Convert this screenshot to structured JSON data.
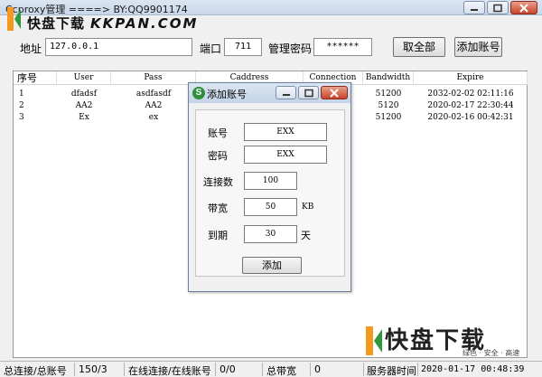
{
  "window": {
    "title": "Ccproxy管理 ====> BY:QQ9901174",
    "buttons": [
      "minimize",
      "maximize",
      "close"
    ]
  },
  "logo": {
    "cn": "快盘下载",
    "en": "KKPAN.COM",
    "icon": "kkpan-logo-icon"
  },
  "toolbar": {
    "address_label": "地址",
    "address_value": "127.0.0.1",
    "port_label": "端口",
    "port_value": "711",
    "password_label": "管理密码",
    "password_value": "******",
    "fetch_all_label": "取全部",
    "add_account_label": "添加账号"
  },
  "table": {
    "columns": [
      "序号",
      "User",
      "Pass",
      "Caddress",
      "Connection",
      "Bandwidth",
      "Expire"
    ],
    "rows": [
      [
        "1",
        "dfadsf",
        "asdfasdf",
        "",
        "",
        "51200",
        "2032-02-02 02:11:16"
      ],
      [
        "2",
        "AA2",
        "AA2",
        "",
        "",
        "5120",
        "2020-02-17 22:30:44"
      ],
      [
        "3",
        "Ex",
        "ex",
        "",
        "",
        "51200",
        "2020-02-16 00:42:31"
      ]
    ]
  },
  "dialog": {
    "title": "添加账号",
    "account_label": "账号",
    "account_value": "EXX",
    "password_label": "密码",
    "password_value": "EXX",
    "connections_label": "连接数",
    "connections_value": "100",
    "bandwidth_label": "带宽",
    "bandwidth_value": "50",
    "bandwidth_unit": "KB",
    "expire_label": "到期",
    "expire_value": "30",
    "expire_unit": "天",
    "add_label": "添加"
  },
  "status": {
    "conn_label": "总连接/总账号",
    "conn_value": "150/3",
    "online_label": "在线连接/在线账号",
    "online_value": "0/0",
    "bandwidth_label": "总带宽",
    "bandwidth_value": "0",
    "time_label": "服务器时间",
    "time_value": "2020-01-17 00:48:39"
  },
  "watermark": {
    "text": "快盘下载",
    "sub": "绿色 · 安全 · 高速"
  },
  "colors": {
    "accent_green": "#2c9a3a",
    "close_red": "#c8432b",
    "titlebar": "#c9d7ea"
  }
}
